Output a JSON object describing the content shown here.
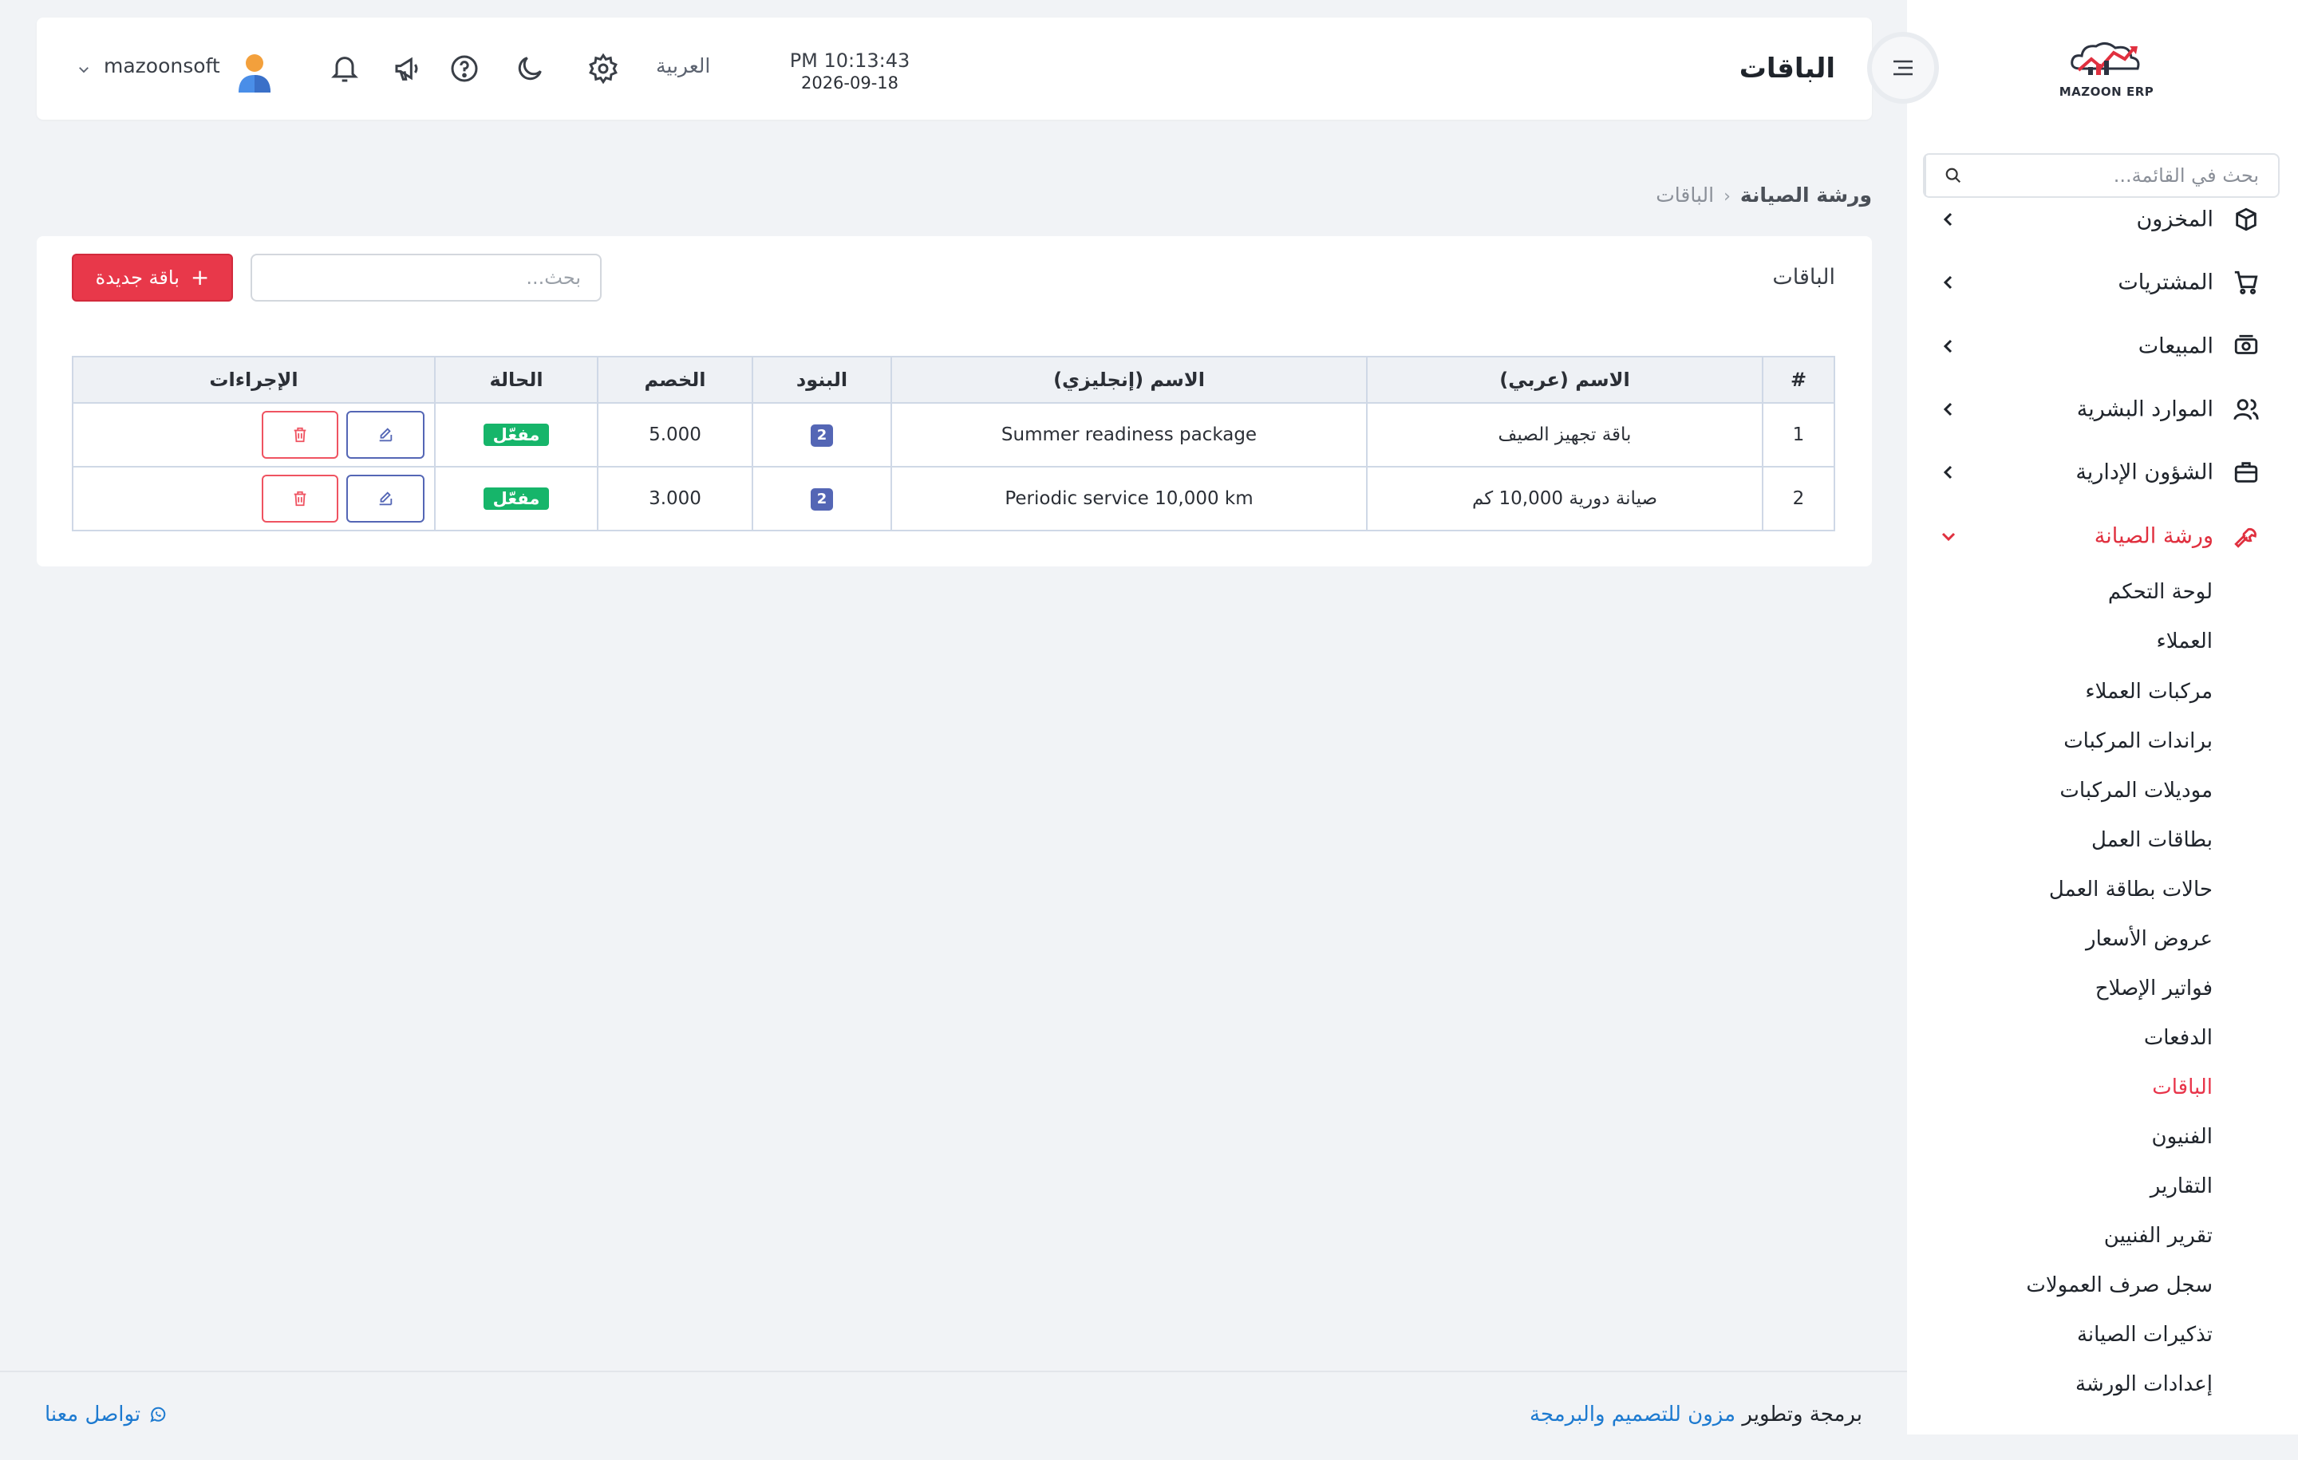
{
  "app": {
    "logo_text": "MAZOON ERP",
    "logo_mark_text": "ERP"
  },
  "sidebar": {
    "search_placeholder": "بحث في القائمة...",
    "items": [
      {
        "label": "المخزون",
        "icon": "box-icon"
      },
      {
        "label": "المشتريات",
        "icon": "cart-icon"
      },
      {
        "label": "المبيعات",
        "icon": "cash-icon"
      },
      {
        "label": "الموارد البشرية",
        "icon": "users-icon"
      },
      {
        "label": "الشؤون الإدارية",
        "icon": "briefcase-icon"
      },
      {
        "label": "ورشة الصيانة",
        "icon": "wrench-icon",
        "expanded": true
      }
    ],
    "sub_items": [
      {
        "label": "لوحة التحكم"
      },
      {
        "label": "العملاء"
      },
      {
        "label": "مركبات العملاء"
      },
      {
        "label": "براندات المركبات"
      },
      {
        "label": "موديلات المركبات"
      },
      {
        "label": "بطاقات العمل"
      },
      {
        "label": "حالات بطاقة العمل"
      },
      {
        "label": "عروض الأسعار"
      },
      {
        "label": "فواتير الإصلاح"
      },
      {
        "label": "الدفعات"
      },
      {
        "label": "الباقات",
        "active": true
      },
      {
        "label": "الفنيون"
      },
      {
        "label": "التقارير"
      },
      {
        "label": "تقرير الفنيين"
      },
      {
        "label": "سجل صرف العمولات"
      },
      {
        "label": "تذكيرات الصيانة"
      },
      {
        "label": "إعدادات الورشة"
      }
    ]
  },
  "header": {
    "title": "الباقات",
    "time": "PM 10:13:43",
    "date": "2026-09-18",
    "language": "العربية",
    "username": "mazoonsoft"
  },
  "breadcrumb": {
    "parent": "ورشة الصيانة",
    "current": "الباقات"
  },
  "card": {
    "title": "الباقات",
    "search_placeholder": "بحث...",
    "new_button": "باقة جديدة"
  },
  "table": {
    "columns": [
      "#",
      "الاسم (عربي)",
      "الاسم (إنجليزي)",
      "البنود",
      "الخصم",
      "الحالة",
      "الإجراءات"
    ],
    "rows": [
      {
        "num": "1",
        "name_ar": "باقة تجهيز الصيف",
        "name_en": "Summer readiness package",
        "items": "2",
        "discount": "5.000",
        "status": "مفعّل"
      },
      {
        "num": "2",
        "name_ar": "صيانة دورية 10,000 كم",
        "name_en": "Periodic service 10,000 km",
        "items": "2",
        "discount": "3.000",
        "status": "مفعّل"
      }
    ]
  },
  "footer": {
    "credit_prefix": "برمجة وتطوير",
    "credit_link": "مزون للتصميم والبرمجة",
    "contact": "تواصل معنا"
  },
  "colors": {
    "accent_red": "#e8384a",
    "primary_blue": "#5466b5",
    "success_green": "#16b56a",
    "link_blue": "#1d7ad0"
  }
}
